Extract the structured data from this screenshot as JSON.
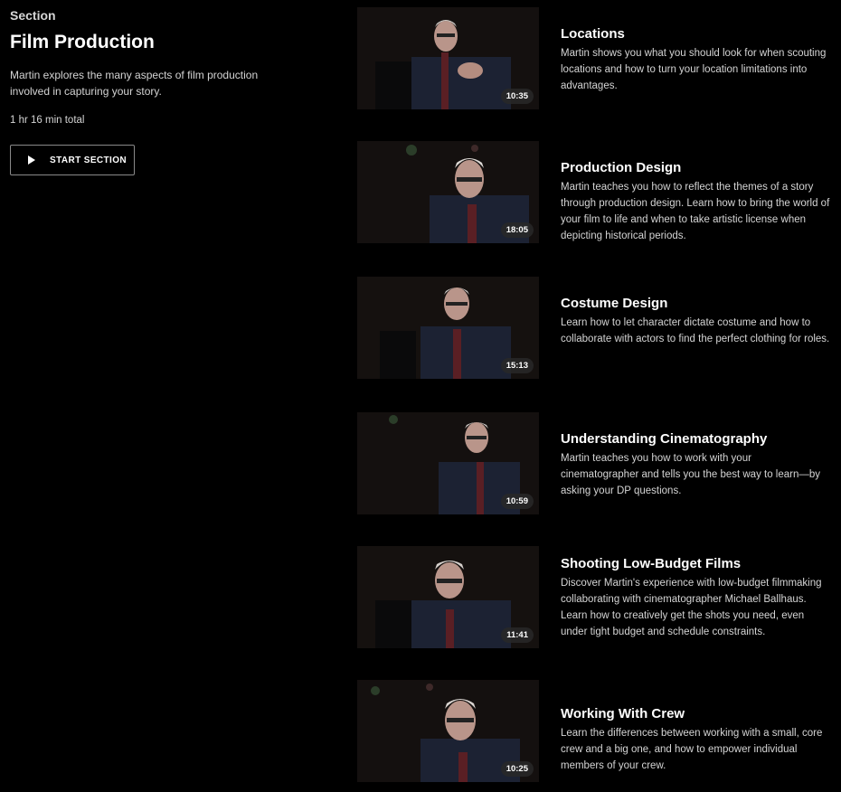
{
  "section": {
    "eyebrow": "Section",
    "title": "Film Production",
    "description": "Martin explores the many aspects of film production involved in capturing your story.",
    "total": "1 hr 16 min total",
    "start_label": "START SECTION"
  },
  "lessons": [
    {
      "title": "Locations",
      "description": "Martin shows you what you should look for when scouting locations and how to turn your location limitations into advantages.",
      "duration": "10:35"
    },
    {
      "title": "Production Design",
      "description": "Martin teaches you how to reflect the themes of a story through production design. Learn how to bring the world of your film to life and when to take artistic license when depicting historical periods.",
      "duration": "18:05"
    },
    {
      "title": "Costume Design",
      "description": "Learn how to let character dictate costume and how to collaborate with actors to find the perfect clothing for roles.",
      "duration": "15:13"
    },
    {
      "title": "Understanding Cinematography",
      "description": "Martin teaches you how to work with your cinematographer and tells you the best way to learn—by asking your DP questions.",
      "duration": "10:59"
    },
    {
      "title": "Shooting Low-Budget Films",
      "description": "Discover Martin's experience with low-budget filmmaking collaborating with cinematographer Michael Ballhaus. Learn how to creatively get the shots you need, even under tight budget and schedule constraints.",
      "duration": "11:41"
    },
    {
      "title": "Working With Crew",
      "description": "Learn the differences between working with a small, core crew and a big one, and how to empower individual members of your crew.",
      "duration": "10:25"
    }
  ]
}
